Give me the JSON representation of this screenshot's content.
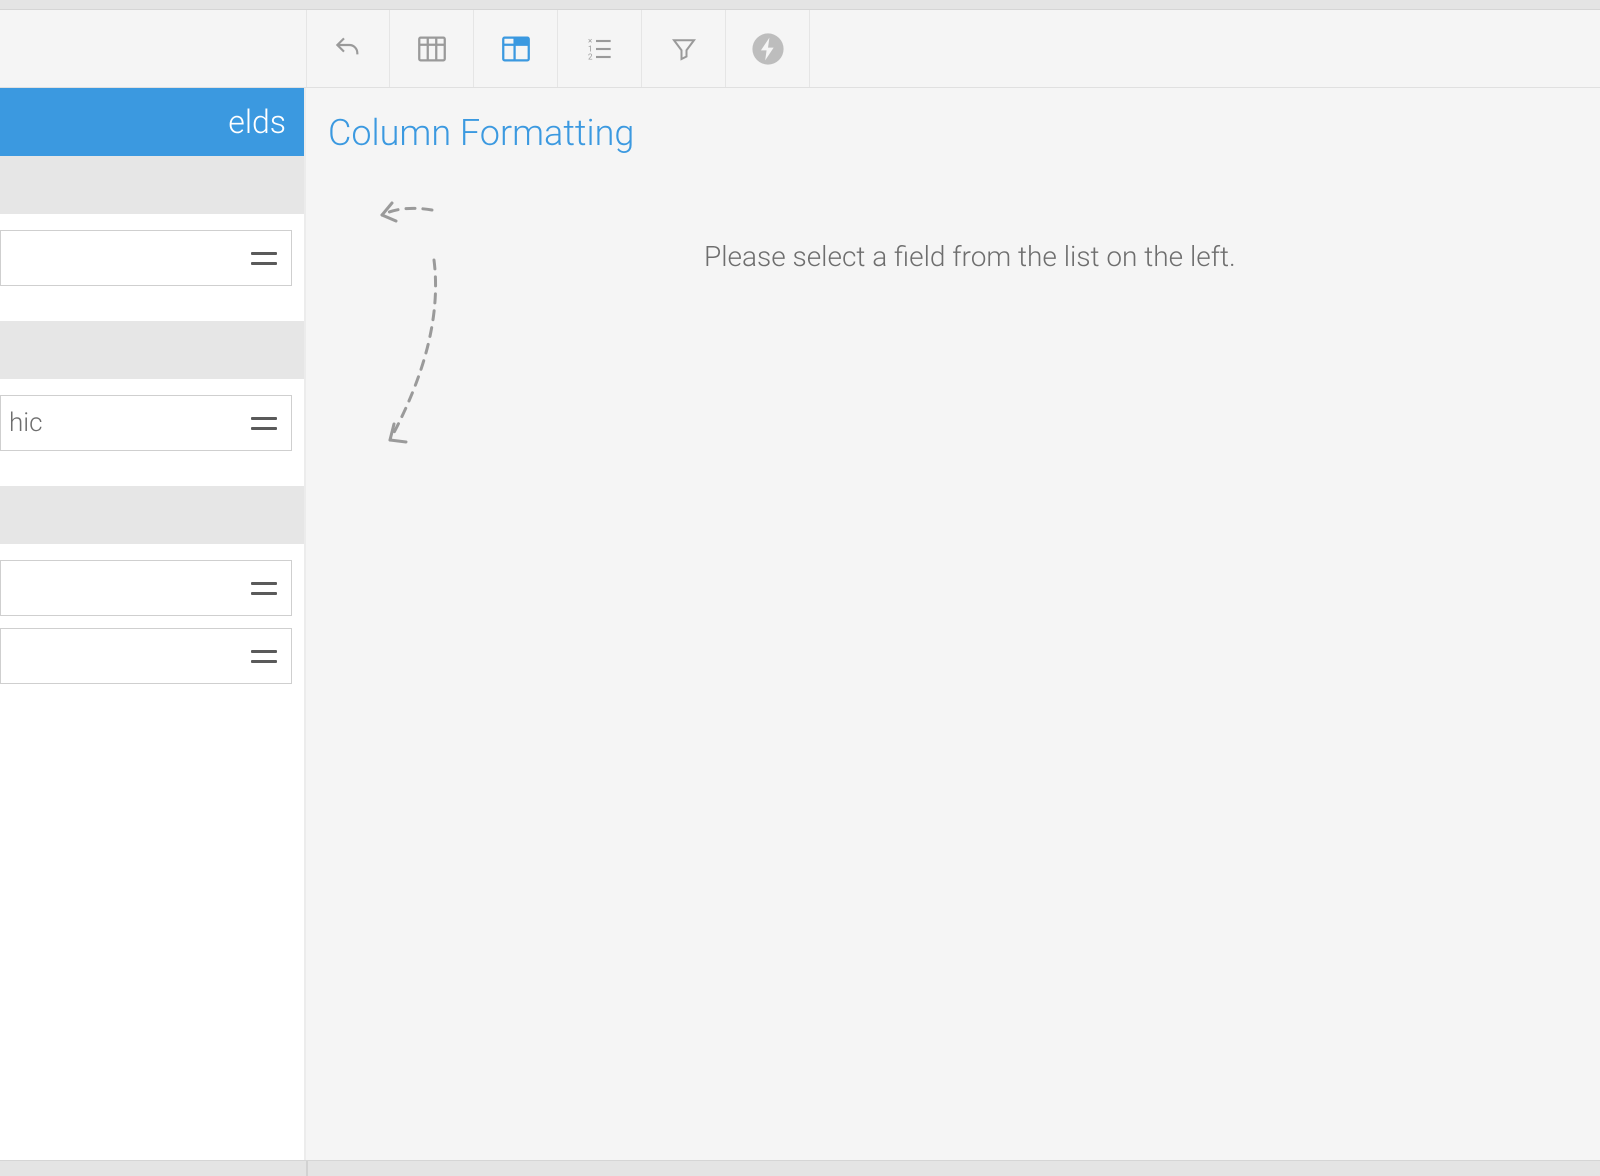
{
  "sidebar": {
    "title_fragment": "elds",
    "groups": [
      {
        "items": [
          {
            "label": ""
          }
        ]
      },
      {
        "items": [
          {
            "label": "hic"
          }
        ]
      },
      {
        "items": [
          {
            "label": ""
          },
          {
            "label": ""
          }
        ]
      }
    ]
  },
  "toolbar": {
    "buttons": [
      {
        "name": "undo",
        "active": false
      },
      {
        "name": "table-layout",
        "active": false
      },
      {
        "name": "column-formatting",
        "active": true
      },
      {
        "name": "list-sort",
        "active": false
      },
      {
        "name": "filter",
        "active": false
      },
      {
        "name": "bolt",
        "active": false,
        "disabled": true
      }
    ]
  },
  "main": {
    "title": "Column Formatting",
    "empty_message": "Please select a field from the list on the left."
  }
}
